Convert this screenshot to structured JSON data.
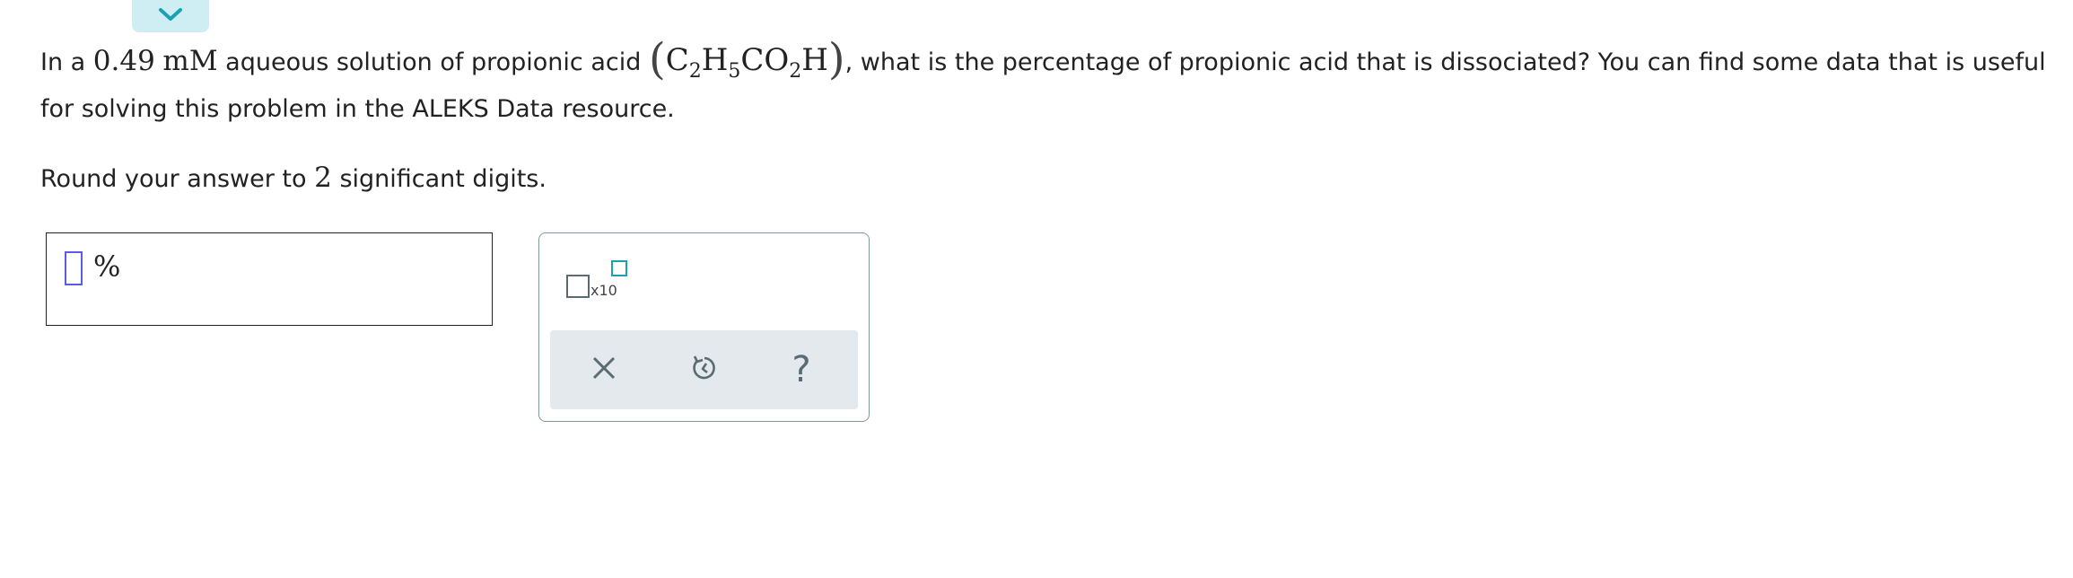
{
  "question": {
    "part1": "In a",
    "concentration_value": "0.49",
    "concentration_unit": "mM",
    "part2": "aqueous solution of propionic acid",
    "formula": {
      "open_paren": "(",
      "c": "C",
      "c_sub": "2",
      "h": "H",
      "h_sub": "5",
      "co": "CO",
      "o_sub": "2",
      "h_end": "H",
      "close_paren": ")"
    },
    "part3": ", what is the percentage of propionic acid that is dissociated? You can find some data that is useful for solving this problem in the ALEKS Data resource."
  },
  "round": {
    "prefix": "Round your answer to",
    "digits": "2",
    "suffix": "significant digits."
  },
  "answer": {
    "value": "",
    "unit": "%"
  },
  "toolbar": {
    "sci_notation_label": "x10",
    "clear_icon": "close-icon",
    "undo_icon": "undo-icon",
    "help_label": "?"
  },
  "colors": {
    "accent": "#1aa1b6",
    "cursor": "#5b5bea",
    "panel_border": "#7c98a5",
    "action_bar": "#e3e9ec",
    "icon": "#5b6b73",
    "collapse_tab": "#cfeef4"
  }
}
